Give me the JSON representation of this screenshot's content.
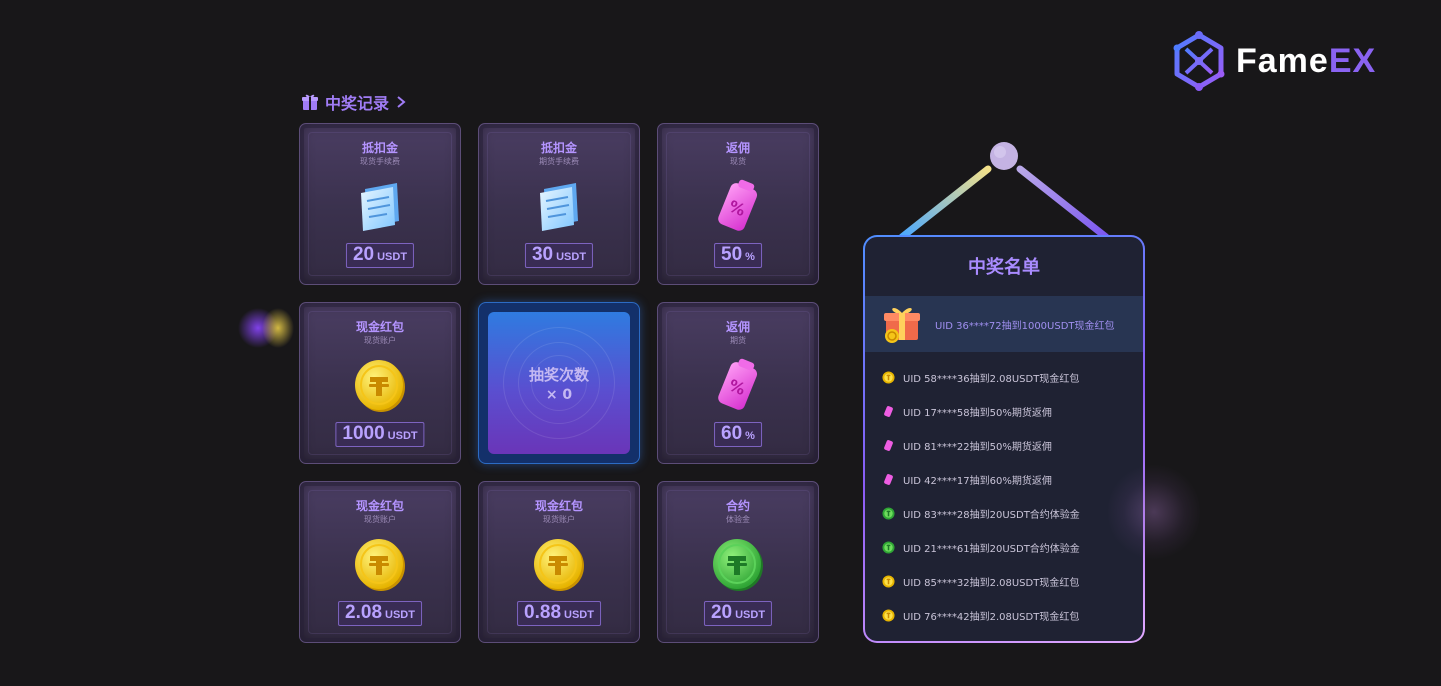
{
  "brand": {
    "name_main": "Fame",
    "name_accent": "EX",
    "logo_icon": "fameex-logo-icon"
  },
  "records": {
    "label": "中奖记录",
    "icon": "gift-icon",
    "chevron": "chevron-right-icon"
  },
  "prizes": [
    {
      "title": "抵扣金",
      "subtitle": "现货手续费",
      "value": "20",
      "unit": "USDT",
      "icon": "ticket-icon"
    },
    {
      "title": "抵扣金",
      "subtitle": "期货手续费",
      "value": "30",
      "unit": "USDT",
      "icon": "ticket-icon"
    },
    {
      "title": "返佣",
      "subtitle": "现货",
      "value": "50",
      "unit": "%",
      "icon": "rebate-tag-icon"
    },
    {
      "title": "现金红包",
      "subtitle": "现货账户",
      "value": "1000",
      "unit": "USDT",
      "icon": "gold-coin-icon"
    },
    {
      "title": "返佣",
      "subtitle": "期货",
      "value": "60",
      "unit": "%",
      "icon": "rebate-tag-icon"
    },
    {
      "title": "现金红包",
      "subtitle": "现货账户",
      "value": "2.08",
      "unit": "USDT",
      "icon": "gold-coin-icon"
    },
    {
      "title": "现金红包",
      "subtitle": "现货账户",
      "value": "0.88",
      "unit": "USDT",
      "icon": "gold-coin-icon"
    },
    {
      "title": "合约",
      "subtitle": "体验金",
      "value": "20",
      "unit": "USDT",
      "icon": "green-coin-icon"
    }
  ],
  "draw": {
    "label": "抽奖次数",
    "count": "× 0"
  },
  "winners": {
    "title": "中奖名单",
    "featured": {
      "text": "UID 36****72抽到1000USDT现金红包",
      "icon": "gift-box-icon"
    },
    "items": [
      {
        "text": "UID 58****36抽到2.08USDT现金红包",
        "icon": "gold-coin-icon"
      },
      {
        "text": "UID 17****58抽到50%期货返佣",
        "icon": "rebate-tag-icon"
      },
      {
        "text": "UID 81****22抽到50%期货返佣",
        "icon": "rebate-tag-icon"
      },
      {
        "text": "UID 42****17抽到60%期货返佣",
        "icon": "rebate-tag-icon"
      },
      {
        "text": "UID 83****28抽到20USDT合约体验金",
        "icon": "green-coin-icon"
      },
      {
        "text": "UID 21****61抽到20USDT合约体验金",
        "icon": "green-coin-icon"
      },
      {
        "text": "UID 85****32抽到2.08USDT现金红包",
        "icon": "gold-coin-icon"
      },
      {
        "text": "UID 76****42抽到2.08USDT现金红包",
        "icon": "gold-coin-icon"
      }
    ]
  },
  "colors": {
    "background": "#181719",
    "accent": "#8a63f2",
    "cell": "#3e3452",
    "board": "#1f2233"
  }
}
